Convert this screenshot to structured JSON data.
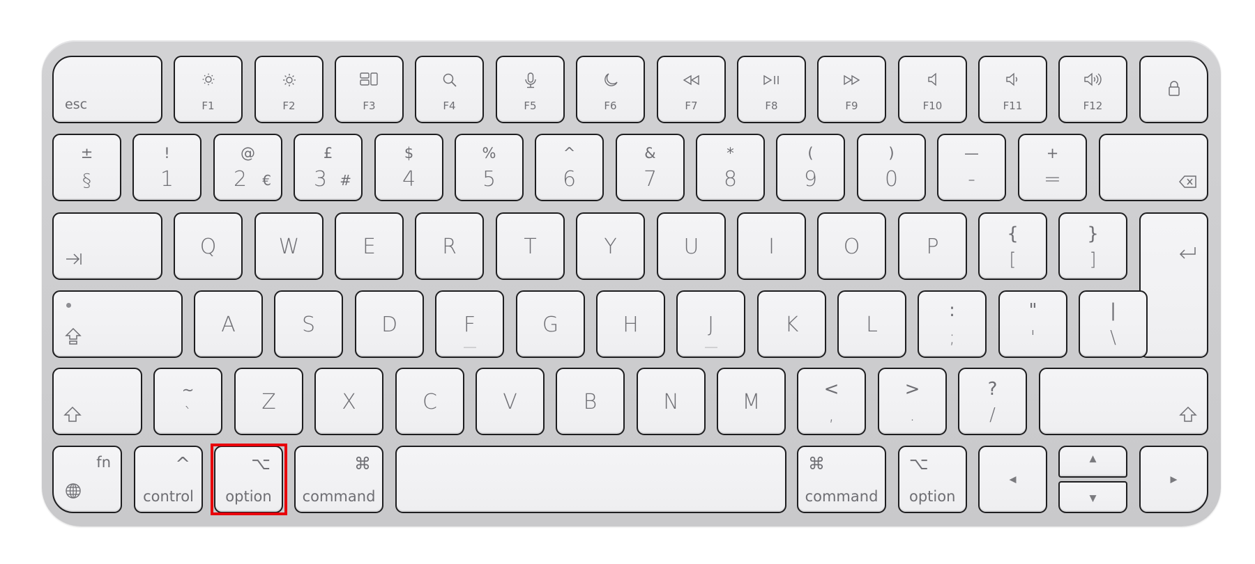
{
  "keyboard": {
    "name": "Magic Keyboard (British layout)",
    "highlight_color": "#e8000b",
    "highlighted_key": "option-left",
    "row_function": [
      {
        "id": "esc",
        "label": "esc"
      },
      {
        "id": "f1",
        "label": "F1",
        "icon": "brightness-down-icon"
      },
      {
        "id": "f2",
        "label": "F2",
        "icon": "brightness-up-icon"
      },
      {
        "id": "f3",
        "label": "F3",
        "icon": "mission-control-icon"
      },
      {
        "id": "f4",
        "label": "F4",
        "icon": "search-icon"
      },
      {
        "id": "f5",
        "label": "F5",
        "icon": "microphone-icon"
      },
      {
        "id": "f6",
        "label": "F6",
        "icon": "moon-icon"
      },
      {
        "id": "f7",
        "label": "F7",
        "icon": "rewind-icon"
      },
      {
        "id": "f8",
        "label": "F8",
        "icon": "play-pause-icon"
      },
      {
        "id": "f9",
        "label": "F9",
        "icon": "fast-forward-icon"
      },
      {
        "id": "f10",
        "label": "F10",
        "icon": "mute-icon"
      },
      {
        "id": "f11",
        "label": "F11",
        "icon": "volume-down-icon"
      },
      {
        "id": "f12",
        "label": "F12",
        "icon": "volume-up-icon"
      },
      {
        "id": "lock",
        "label": "",
        "icon": "lock-icon"
      }
    ],
    "row_number": [
      {
        "top": "±",
        "bottom": "§"
      },
      {
        "top": "!",
        "bottom": "1"
      },
      {
        "top": "@",
        "bottom": "2",
        "alt": "€"
      },
      {
        "top": "£",
        "bottom": "3",
        "alt": "#"
      },
      {
        "top": "$",
        "bottom": "4"
      },
      {
        "top": "%",
        "bottom": "5"
      },
      {
        "top": "^",
        "bottom": "6"
      },
      {
        "top": "&",
        "bottom": "7"
      },
      {
        "top": "*",
        "bottom": "8"
      },
      {
        "top": "(",
        "bottom": "9"
      },
      {
        "top": ")",
        "bottom": "0"
      },
      {
        "top": "—",
        "bottom": "-"
      },
      {
        "top": "+",
        "bottom": "="
      }
    ],
    "backspace_icon": "delete-icon",
    "tab_icon": "tab-icon",
    "row_qwerty": [
      "Q",
      "W",
      "E",
      "R",
      "T",
      "Y",
      "U",
      "I",
      "O",
      "P"
    ],
    "row_qwerty_brackets": [
      {
        "top": "{",
        "bottom": "["
      },
      {
        "top": "}",
        "bottom": "]"
      }
    ],
    "return_icon": "return-icon",
    "caps_icon": "caps-lock-icon",
    "row_home": [
      "A",
      "S",
      "D",
      "F",
      "G",
      "H",
      "J",
      "K",
      "L"
    ],
    "row_home_symbols": [
      {
        "top": ":",
        "bottom": ";"
      },
      {
        "top": "\"",
        "bottom": "'"
      },
      {
        "top": "|",
        "bottom": "\\"
      }
    ],
    "shift_icon": "shift-icon",
    "row_bottom_first": {
      "top": "~",
      "bottom": "`"
    },
    "row_bottom": [
      "Z",
      "X",
      "C",
      "V",
      "B",
      "N",
      "M"
    ],
    "row_bottom_symbols": [
      {
        "top": "<",
        "bottom": ","
      },
      {
        "top": ">",
        "bottom": "."
      },
      {
        "top": "?",
        "bottom": "/"
      }
    ],
    "modifiers": {
      "fn": {
        "label": "fn",
        "icon": "globe-icon"
      },
      "control": {
        "label": "control",
        "symbol": "^"
      },
      "option_left": {
        "label": "option",
        "symbol": "⌥"
      },
      "command_left": {
        "label": "command",
        "symbol": "⌘"
      },
      "command_right": {
        "label": "command",
        "symbol": "⌘"
      },
      "option_right": {
        "label": "option",
        "symbol": "⌥"
      }
    },
    "arrows": {
      "left": "◀",
      "up": "▲",
      "down": "▼",
      "right": "▶"
    }
  }
}
